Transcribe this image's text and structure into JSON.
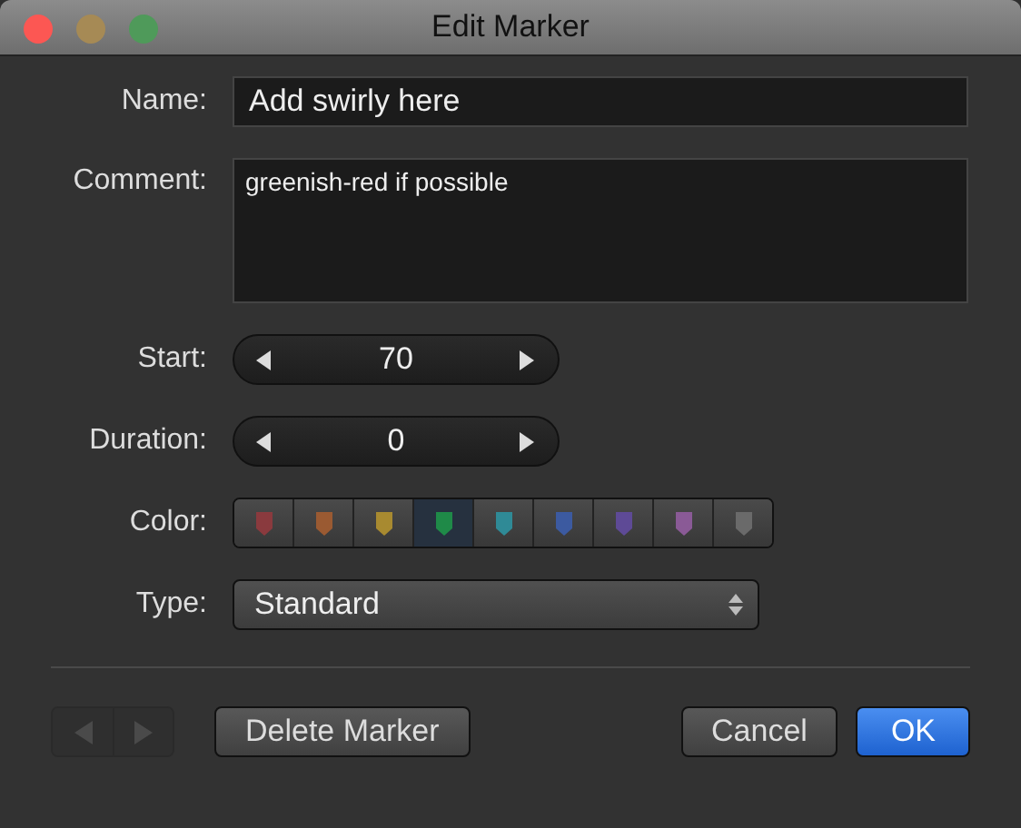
{
  "window": {
    "title": "Edit Marker"
  },
  "name": {
    "label": "Name:",
    "value": "Add swirly here"
  },
  "comment": {
    "label": "Comment:",
    "value": "greenish-red if possible"
  },
  "start": {
    "label": "Start:",
    "value": "70"
  },
  "duration": {
    "label": "Duration:",
    "value": "0"
  },
  "color": {
    "label": "Color:",
    "swatches": [
      {
        "color": "#8a3a3e",
        "selected": false
      },
      {
        "color": "#9a5a32",
        "selected": false
      },
      {
        "color": "#a88a30",
        "selected": false
      },
      {
        "color": "#1f8a48",
        "selected": true
      },
      {
        "color": "#2f8a96",
        "selected": false
      },
      {
        "color": "#3c5aa0",
        "selected": false
      },
      {
        "color": "#5e4a96",
        "selected": false
      },
      {
        "color": "#8a5a96",
        "selected": false
      },
      {
        "color": "#6a6a6a",
        "selected": false
      }
    ]
  },
  "type": {
    "label": "Type:",
    "value": "Standard"
  },
  "nav": {
    "disabled": true
  },
  "buttons": {
    "delete": "Delete Marker",
    "cancel": "Cancel",
    "ok": "OK"
  }
}
